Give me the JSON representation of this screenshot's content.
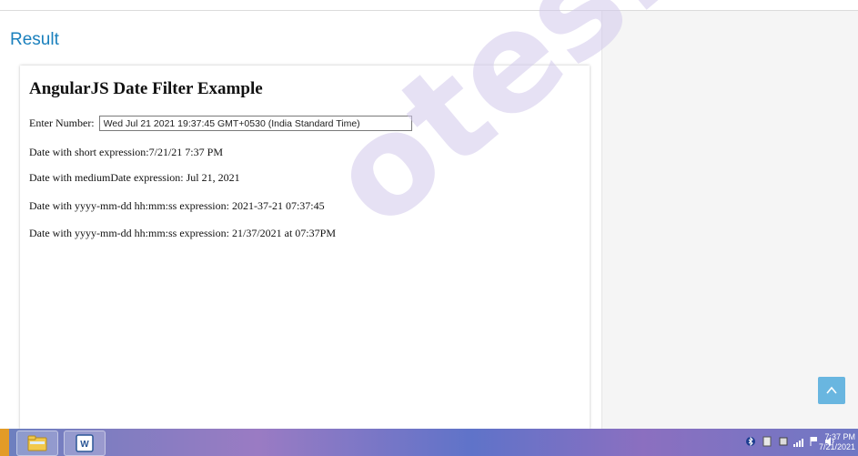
{
  "result_heading": "Result",
  "page_title": "AngularJS Date Filter Example",
  "input": {
    "label": "Enter Number:",
    "value": "Wed Jul 21 2021 19:37:45 GMT+0530 (India Standard Time)"
  },
  "lines": [
    "Date with short expression:7/21/21 7:37 PM",
    "Date with mediumDate expression: Jul 21, 2021",
    "Date with yyyy-mm-dd hh:mm:ss expression: 2021-37-21 07:37:45",
    "Date with yyyy-mm-dd hh:mm:ss expression: 21/37/2021 at 07:37PM"
  ],
  "watermark": "otes.in",
  "taskbar": {
    "clock_time": "7:37 PM",
    "clock_date": "7/21/2021",
    "word_badge": "W"
  },
  "colors": {
    "heading": "#1a80bd",
    "scroll_button": "#69b6e0",
    "watermark": "#d2c8eb"
  },
  "icons": [
    "chevron-up-icon",
    "folder-icon",
    "word-icon",
    "bluetooth-icon",
    "signal-icon",
    "flag-icon",
    "speaker-icon"
  ]
}
